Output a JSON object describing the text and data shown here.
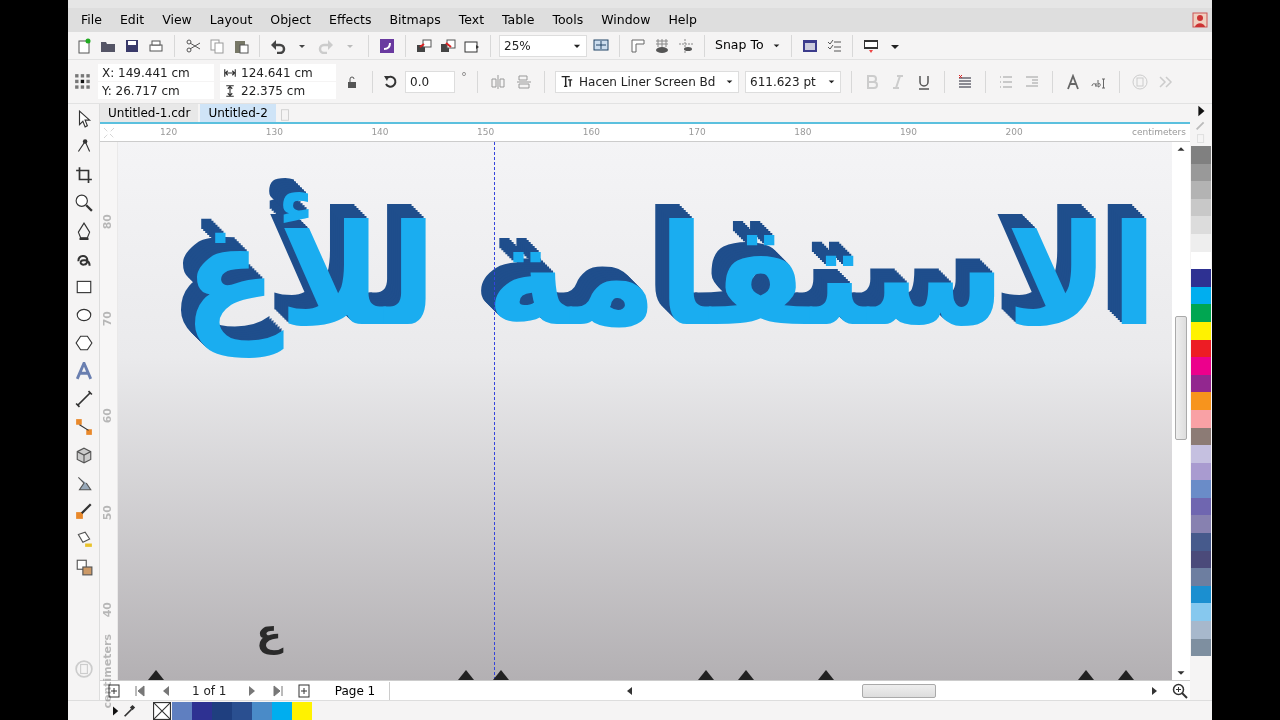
{
  "menu": [
    {
      "label": "File"
    },
    {
      "label": "Edit"
    },
    {
      "label": "View"
    },
    {
      "label": "Layout"
    },
    {
      "label": "Object"
    },
    {
      "label": "Effects"
    },
    {
      "label": "Bitmaps"
    },
    {
      "label": "Text"
    },
    {
      "label": "Table"
    },
    {
      "label": "Tools"
    },
    {
      "label": "Window"
    },
    {
      "label": "Help"
    }
  ],
  "toolbar": {
    "zoom": "25%",
    "snap": "Snap To"
  },
  "property_bar": {
    "x": "X: 149.441 cm",
    "y": "Y: 26.717 cm",
    "width": "124.641 cm",
    "height": "22.375 cm",
    "angle": "0.0",
    "degree": "°",
    "font": "Hacen Liner Screen Bd",
    "size": "611.623 pt"
  },
  "tabs": [
    {
      "label": "Untitled-1.cdr",
      "selected": false
    },
    {
      "label": "Untitled-2",
      "selected": true
    }
  ],
  "ruler": {
    "h_ticks": [
      "120",
      "130",
      "140",
      "150",
      "160",
      "170",
      "180",
      "190",
      "200"
    ],
    "h_unit": "centimeters",
    "v_ticks": [
      "80",
      "70",
      "60",
      "50",
      "40"
    ],
    "v_unit": "centimeters"
  },
  "canvas": {
    "heading": "الاستقامة للأغ",
    "glyph": "ع"
  },
  "page_nav": {
    "count": "1 of 1",
    "page_tab": "Page 1"
  },
  "palette": [
    {
      "color": "#808080"
    },
    {
      "color": "#999999"
    },
    {
      "color": "#b3b3b3"
    },
    {
      "color": "#c8c8c8"
    },
    {
      "color": "#dcdcdc"
    },
    {
      "color": "#eeeeee"
    },
    {
      "color": "#ffffff"
    },
    {
      "color": "#2e3192"
    },
    {
      "color": "#00aeef"
    },
    {
      "color": "#00a651"
    },
    {
      "color": "#fff200"
    },
    {
      "color": "#ed1c24"
    },
    {
      "color": "#ec008c"
    },
    {
      "color": "#92278f"
    },
    {
      "color": "#f7941d"
    },
    {
      "color": "#f9a1a5"
    },
    {
      "color": "#8c7b75"
    },
    {
      "color": "#c5c0e0"
    },
    {
      "color": "#a99bd0"
    },
    {
      "color": "#6a8cc8"
    },
    {
      "color": "#6f66b0"
    },
    {
      "color": "#8781b0"
    },
    {
      "color": "#465a8c"
    },
    {
      "color": "#4b4a7a"
    },
    {
      "color": "#6d7ea0"
    },
    {
      "color": "#1b8fd0"
    },
    {
      "color": "#86c8ee"
    },
    {
      "color": "#a7b8cc"
    },
    {
      "color": "#7e8fa0"
    }
  ],
  "document_palette": [
    {
      "color": "#5f7fc0"
    },
    {
      "color": "#2e3192"
    },
    {
      "color": "#1f3f7f"
    },
    {
      "color": "#2a4f90"
    },
    {
      "color": "#4a8bc8"
    },
    {
      "color": "#00aeef"
    },
    {
      "color": "#fff200"
    }
  ]
}
